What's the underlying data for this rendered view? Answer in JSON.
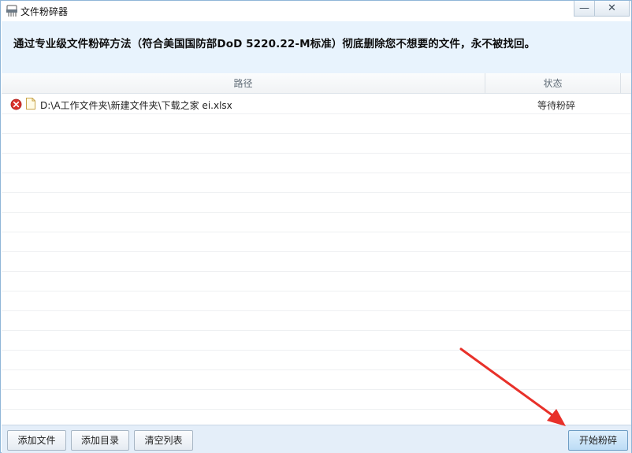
{
  "window": {
    "title": "文件粉碎器",
    "controls": {
      "minimize": "—",
      "close": "✕"
    }
  },
  "banner": {
    "text": "通过专业级文件粉碎方法（符合美国国防部DoD 5220.22-M标准）彻底删除您不想要的文件，永不被找回。"
  },
  "table": {
    "columns": {
      "path": "路径",
      "status": "状态"
    },
    "rows": [
      {
        "path": "D:\\A工作文件夹\\新建文件夹\\下载之家 ei.xlsx",
        "status": "等待粉碎"
      }
    ]
  },
  "toolbar": {
    "add_file": "添加文件",
    "add_dir": "添加目录",
    "clear_list": "清空列表",
    "start_shred": "开始粉碎"
  },
  "colors": {
    "banner_bg": "#e8f3fd",
    "toolbar_bg": "#e4eef9",
    "annotation_arrow": "#e8312a",
    "remove_icon": "#d9302a"
  },
  "icons": {
    "app": "shredder-icon",
    "remove": "remove-icon",
    "file": "file-icon",
    "arrow": "annotation-arrow"
  }
}
